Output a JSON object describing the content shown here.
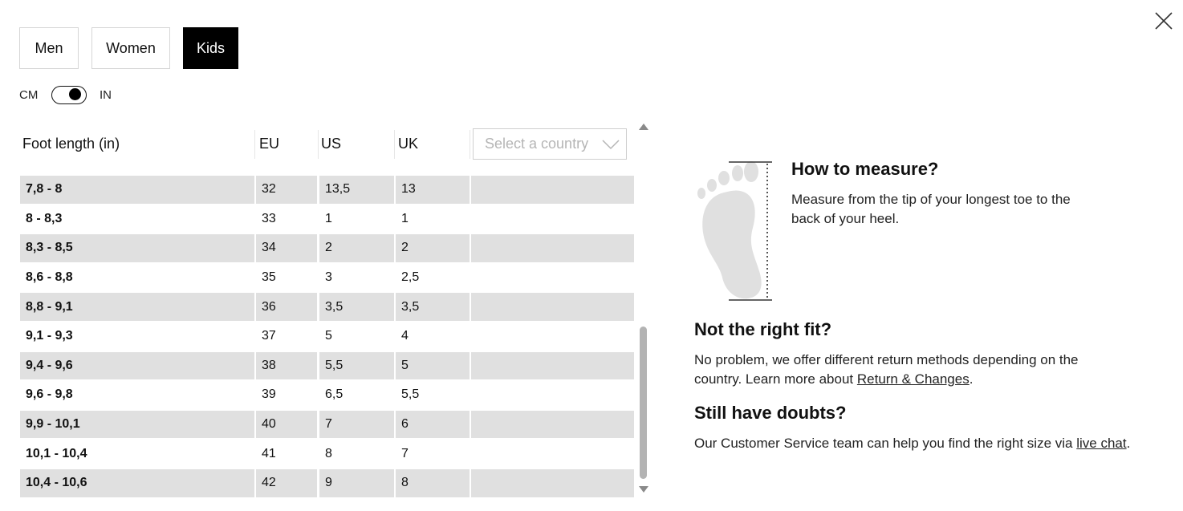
{
  "tabs": [
    {
      "label": "Men",
      "active": false
    },
    {
      "label": "Women",
      "active": false
    },
    {
      "label": "Kids",
      "active": true
    }
  ],
  "units": {
    "left": "CM",
    "right": "IN",
    "selected": "IN"
  },
  "table": {
    "headers": {
      "foot": "Foot length (in)",
      "eu": "EU",
      "us": "US",
      "uk": "UK"
    },
    "country_placeholder": "Select a country",
    "rows": [
      {
        "foot": "7,8 - 8",
        "eu": "32",
        "us": "13,5",
        "uk": "13"
      },
      {
        "foot": "8 - 8,3",
        "eu": "33",
        "us": "1",
        "uk": "1"
      },
      {
        "foot": "8,3 - 8,5",
        "eu": "34",
        "us": "2",
        "uk": "2"
      },
      {
        "foot": "8,6 - 8,8",
        "eu": "35",
        "us": "3",
        "uk": "2,5"
      },
      {
        "foot": "8,8 - 9,1",
        "eu": "36",
        "us": "3,5",
        "uk": "3,5"
      },
      {
        "foot": "9,1 - 9,3",
        "eu": "37",
        "us": "5",
        "uk": "4"
      },
      {
        "foot": "9,4 - 9,6",
        "eu": "38",
        "us": "5,5",
        "uk": "5"
      },
      {
        "foot": "9,6 - 9,8",
        "eu": "39",
        "us": "6,5",
        "uk": "5,5"
      },
      {
        "foot": "9,9 - 10,1",
        "eu": "40",
        "us": "7",
        "uk": "6"
      },
      {
        "foot": "10,1 - 10,4",
        "eu": "41",
        "us": "8",
        "uk": "7"
      },
      {
        "foot": "10,4 - 10,6",
        "eu": "42",
        "us": "9",
        "uk": "8"
      }
    ]
  },
  "info": {
    "measure_title": "How to measure?",
    "measure_text": "Measure from the tip of your longest toe to the back of your heel.",
    "fit_title": "Not the right fit?",
    "fit_text_before": "No problem, we offer different return methods depending on the country. Learn more about ",
    "fit_link": "Return & Changes",
    "fit_text_after": ".",
    "doubts_title": "Still have doubts?",
    "doubts_text_before": "Our Customer Service team can help you find the right size via ",
    "doubts_link": "live chat",
    "doubts_text_after": "."
  },
  "icons": {
    "close": "close-icon",
    "toggle": "toggle-switch",
    "chevron": "chevron-down-icon",
    "foot": "foot-icon"
  },
  "colors": {
    "active_tab_bg": "#000000",
    "row_shade": "#e0e0e0",
    "border": "#d6d6d6",
    "placeholder": "#b5b5b5"
  }
}
